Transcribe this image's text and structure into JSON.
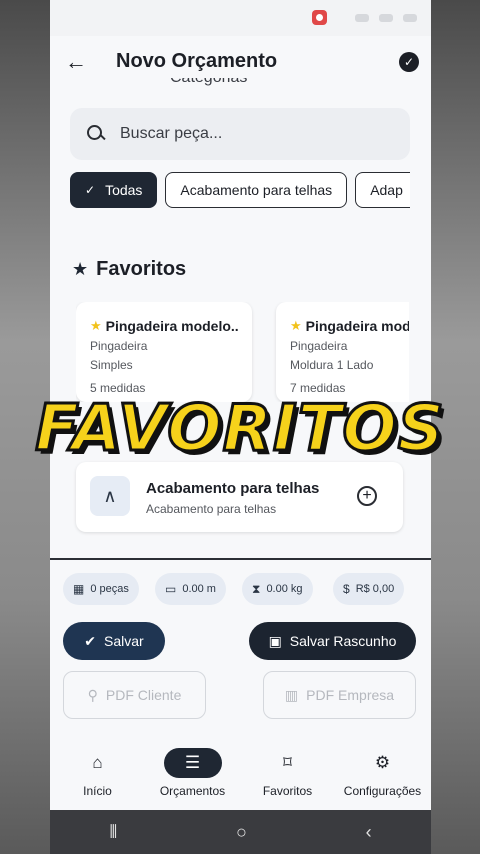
{
  "app": {
    "title": "Novo Orçamento",
    "partial_heading": "Categorias"
  },
  "search": {
    "placeholder": "Buscar peça..."
  },
  "chips": [
    {
      "label": "Todas",
      "selected": true
    },
    {
      "label": "Acabamento para telhas",
      "selected": false
    },
    {
      "label": "Adap",
      "selected": false
    }
  ],
  "favorites": {
    "heading": "Favoritos",
    "items": [
      {
        "name": "Pingadeira modelo...",
        "category": "Pingadeira",
        "type": "Simples",
        "measures": "5 medidas"
      },
      {
        "name": "Pingadeira mod",
        "category": "Pingadeira",
        "type": "Moldura 1 Lado",
        "measures": "7 medidas"
      }
    ]
  },
  "overlay_text": "FAVORITOS",
  "list_item": {
    "name": "Acabamento para telhas",
    "subtitle": "Acabamento para telhas"
  },
  "summary": {
    "pieces": "0 peças",
    "length": "0.00 m",
    "weight": "0.00 kg",
    "price": "R$ 0,00"
  },
  "actions": {
    "save": "Salvar",
    "draft": "Salvar Rascunho",
    "pdf_client": "PDF Cliente",
    "pdf_company": "PDF Empresa"
  },
  "nav": [
    {
      "label": "Início",
      "icon": "home-icon",
      "active": false
    },
    {
      "label": "Orçamentos",
      "icon": "list-icon",
      "active": true
    },
    {
      "label": "Favoritos",
      "icon": "bookmark-icon",
      "active": false
    },
    {
      "label": "Configurações",
      "icon": "gear-icon",
      "active": false
    }
  ],
  "colors": {
    "accent": "#1f2733",
    "star": "#f2c21b",
    "overlay": "#f6d21b"
  }
}
